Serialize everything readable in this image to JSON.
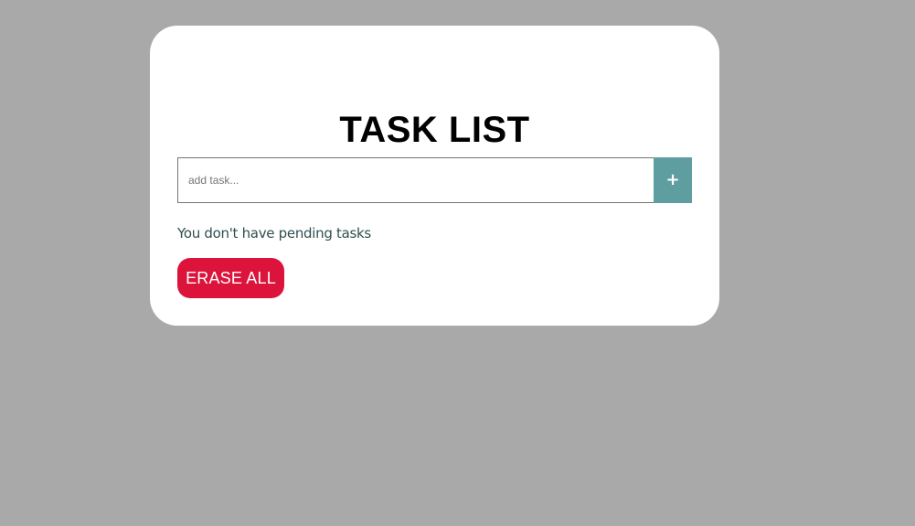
{
  "app": {
    "title": "TASK LIST"
  },
  "form": {
    "input_placeholder": "add task...",
    "input_value": "",
    "add_button_icon": "plus-icon",
    "add_button_glyph": "+"
  },
  "status": {
    "empty_message": "You don't have pending tasks"
  },
  "actions": {
    "erase_all_label": "ERASE ALL"
  },
  "colors": {
    "background": "#a9a9a9",
    "card": "#ffffff",
    "add_button": "#5f9ea0",
    "erase_button": "#dc143c",
    "message_text": "#2f4f4f"
  }
}
